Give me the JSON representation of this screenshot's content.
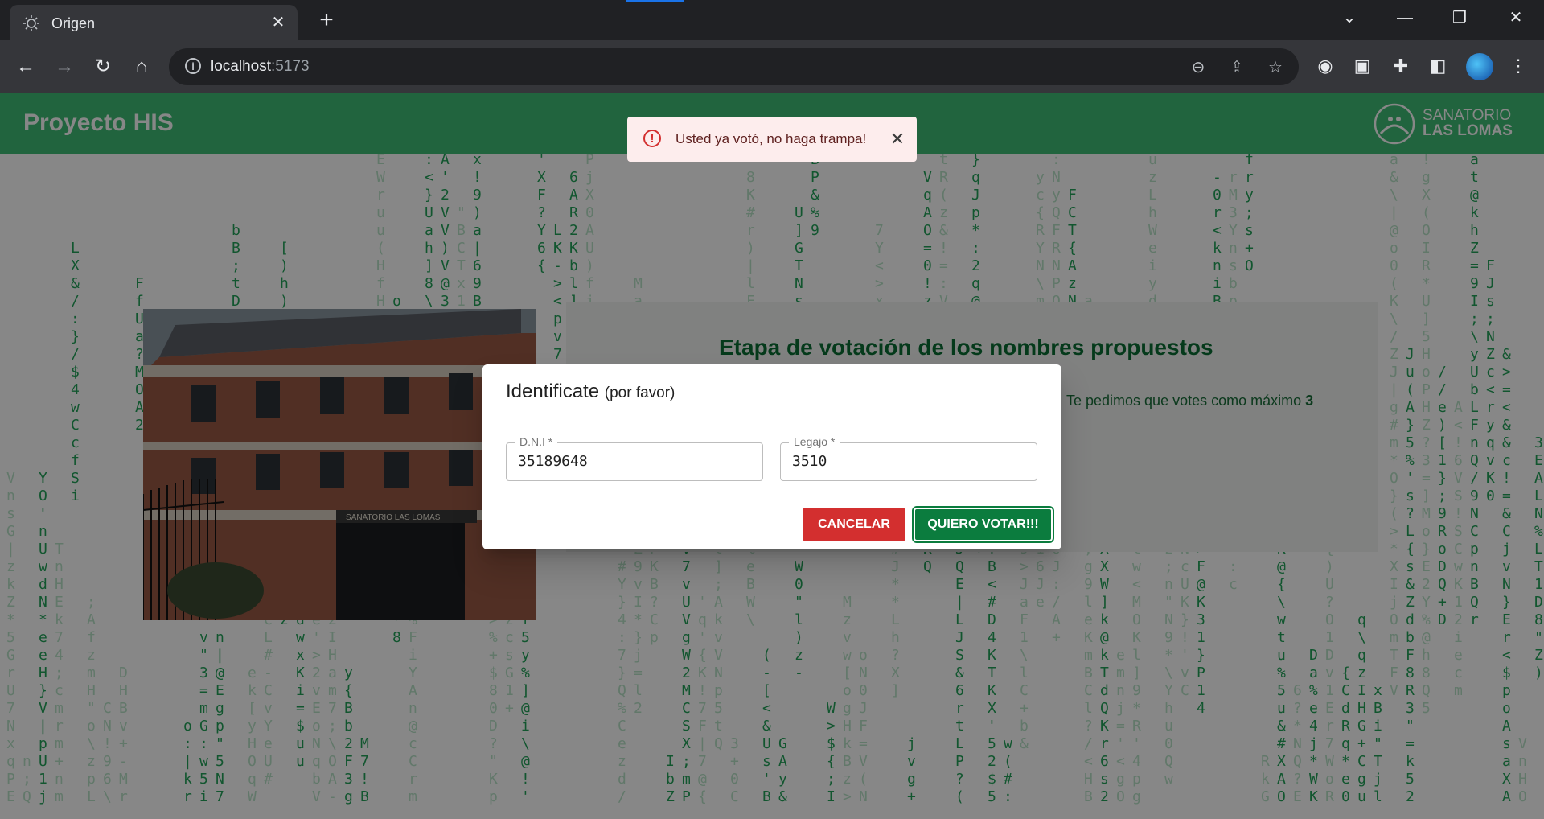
{
  "browser": {
    "tab_title": "Origen",
    "url_host": "localhost",
    "url_port": ":5173",
    "icons": {
      "tab_favicon": "lightbulb-icon",
      "tab_close": "close-icon",
      "new_tab": "plus-icon",
      "tab_search": "chevron-down-icon",
      "minimize": "minimize-icon",
      "restore": "restore-icon",
      "close_window": "close-icon",
      "back": "arrow-left-icon",
      "forward": "arrow-right-icon",
      "reload": "reload-icon",
      "home": "home-icon",
      "site_info": "info-icon",
      "zoom": "zoom-out-icon",
      "share": "share-icon",
      "bookmark": "star-icon",
      "extension_1": "extension-icon",
      "extension_2": "extension-icon",
      "extensions": "puzzle-icon",
      "side_panel": "side-panel-icon",
      "menu": "kebab-menu-icon"
    }
  },
  "app": {
    "title": "Proyecto HIS",
    "logo_line1": "SANATORIO",
    "logo_line2": "LAS LOMAS",
    "header_color": "#3fbd75"
  },
  "card": {
    "title": "Etapa de votación de los nombres propuestos",
    "subtitle_prefix": "Te pedimos que votes como máximo ",
    "subtitle_count": "3"
  },
  "building_sign": "SANATORIO LAS LOMAS",
  "toast": {
    "message": "Usted ya votó, no haga trampa!",
    "severity": "error",
    "icon": "error-outline-icon"
  },
  "dialog": {
    "title": "Identificate",
    "title_suffix": "(por favor)",
    "dni_label": "D.N.I *",
    "dni_value": "35189648",
    "legajo_label": "Legajo *",
    "legajo_value": "3510",
    "cancel_label": "CANCELAR",
    "vote_label": "QUIERO VOTAR!!!"
  },
  "colors": {
    "matrix_green": "#22a35a",
    "cancel_red": "#d32f2f",
    "vote_green": "#0b7c3e",
    "toast_bg": "#fdeded"
  }
}
